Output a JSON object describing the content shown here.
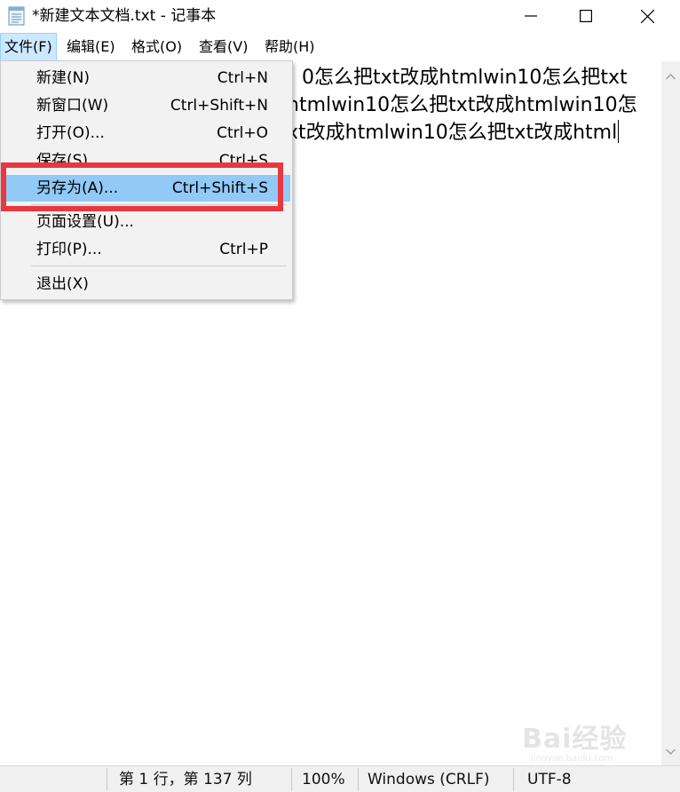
{
  "window": {
    "title": "*新建文本文档.txt - 记事本",
    "icon": "notepad-icon"
  },
  "menubar": {
    "file": "文件(F)",
    "edit": "编辑(E)",
    "format": "格式(O)",
    "view": "查看(V)",
    "help": "帮助(H)"
  },
  "editor": {
    "lines": [
      "0怎么把txt改成htmlwin10怎么把txt",
      "htmlwin10怎么把txt改成htmlwin10怎",
      "xt改成htmlwin10怎么把txt改成html"
    ]
  },
  "file_menu": {
    "items": [
      {
        "label": "新建(N)",
        "shortcut": "Ctrl+N"
      },
      {
        "label": "新窗口(W)",
        "shortcut": "Ctrl+Shift+N"
      },
      {
        "label": "打开(O)...",
        "shortcut": "Ctrl+O"
      },
      {
        "label": "保存(S)",
        "shortcut": "Ctrl+S"
      },
      {
        "label": "另存为(A)...",
        "shortcut": "Ctrl+Shift+S"
      },
      {
        "label": "页面设置(U)...",
        "shortcut": ""
      },
      {
        "label": "打印(P)...",
        "shortcut": "Ctrl+P"
      },
      {
        "label": "退出(X)",
        "shortcut": ""
      }
    ],
    "highlighted_index": 4
  },
  "statusbar": {
    "position": "第 1 行，第 137 列",
    "zoom": "100%",
    "line_ending": "Windows (CRLF)",
    "encoding": "UTF-8"
  },
  "watermark": {
    "text": "Bai经验",
    "sub": "jingyan.baidu.com"
  },
  "colors": {
    "highlight": "#91c9f7",
    "annotation": "#e8373f",
    "menu_active": "#cce8ff"
  }
}
